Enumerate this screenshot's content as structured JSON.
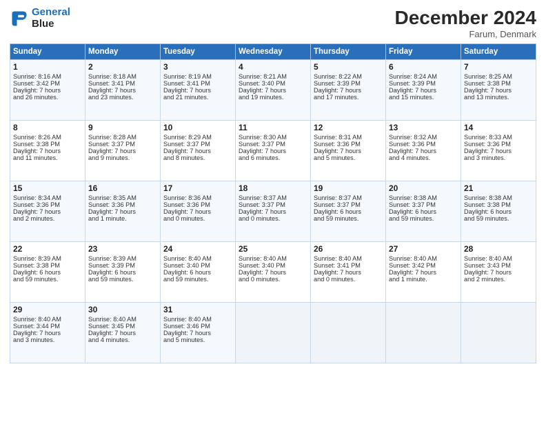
{
  "header": {
    "logo_line1": "General",
    "logo_line2": "Blue",
    "month_title": "December 2024",
    "subtitle": "Farum, Denmark"
  },
  "days_of_week": [
    "Sunday",
    "Monday",
    "Tuesday",
    "Wednesday",
    "Thursday",
    "Friday",
    "Saturday"
  ],
  "weeks": [
    [
      {
        "day": "1",
        "lines": [
          "Sunrise: 8:16 AM",
          "Sunset: 3:42 PM",
          "Daylight: 7 hours",
          "and 26 minutes."
        ]
      },
      {
        "day": "2",
        "lines": [
          "Sunrise: 8:18 AM",
          "Sunset: 3:41 PM",
          "Daylight: 7 hours",
          "and 23 minutes."
        ]
      },
      {
        "day": "3",
        "lines": [
          "Sunrise: 8:19 AM",
          "Sunset: 3:41 PM",
          "Daylight: 7 hours",
          "and 21 minutes."
        ]
      },
      {
        "day": "4",
        "lines": [
          "Sunrise: 8:21 AM",
          "Sunset: 3:40 PM",
          "Daylight: 7 hours",
          "and 19 minutes."
        ]
      },
      {
        "day": "5",
        "lines": [
          "Sunrise: 8:22 AM",
          "Sunset: 3:39 PM",
          "Daylight: 7 hours",
          "and 17 minutes."
        ]
      },
      {
        "day": "6",
        "lines": [
          "Sunrise: 8:24 AM",
          "Sunset: 3:39 PM",
          "Daylight: 7 hours",
          "and 15 minutes."
        ]
      },
      {
        "day": "7",
        "lines": [
          "Sunrise: 8:25 AM",
          "Sunset: 3:38 PM",
          "Daylight: 7 hours",
          "and 13 minutes."
        ]
      }
    ],
    [
      {
        "day": "8",
        "lines": [
          "Sunrise: 8:26 AM",
          "Sunset: 3:38 PM",
          "Daylight: 7 hours",
          "and 11 minutes."
        ]
      },
      {
        "day": "9",
        "lines": [
          "Sunrise: 8:28 AM",
          "Sunset: 3:37 PM",
          "Daylight: 7 hours",
          "and 9 minutes."
        ]
      },
      {
        "day": "10",
        "lines": [
          "Sunrise: 8:29 AM",
          "Sunset: 3:37 PM",
          "Daylight: 7 hours",
          "and 8 minutes."
        ]
      },
      {
        "day": "11",
        "lines": [
          "Sunrise: 8:30 AM",
          "Sunset: 3:37 PM",
          "Daylight: 7 hours",
          "and 6 minutes."
        ]
      },
      {
        "day": "12",
        "lines": [
          "Sunrise: 8:31 AM",
          "Sunset: 3:36 PM",
          "Daylight: 7 hours",
          "and 5 minutes."
        ]
      },
      {
        "day": "13",
        "lines": [
          "Sunrise: 8:32 AM",
          "Sunset: 3:36 PM",
          "Daylight: 7 hours",
          "and 4 minutes."
        ]
      },
      {
        "day": "14",
        "lines": [
          "Sunrise: 8:33 AM",
          "Sunset: 3:36 PM",
          "Daylight: 7 hours",
          "and 3 minutes."
        ]
      }
    ],
    [
      {
        "day": "15",
        "lines": [
          "Sunrise: 8:34 AM",
          "Sunset: 3:36 PM",
          "Daylight: 7 hours",
          "and 2 minutes."
        ]
      },
      {
        "day": "16",
        "lines": [
          "Sunrise: 8:35 AM",
          "Sunset: 3:36 PM",
          "Daylight: 7 hours",
          "and 1 minute."
        ]
      },
      {
        "day": "17",
        "lines": [
          "Sunrise: 8:36 AM",
          "Sunset: 3:36 PM",
          "Daylight: 7 hours",
          "and 0 minutes."
        ]
      },
      {
        "day": "18",
        "lines": [
          "Sunrise: 8:37 AM",
          "Sunset: 3:37 PM",
          "Daylight: 7 hours",
          "and 0 minutes."
        ]
      },
      {
        "day": "19",
        "lines": [
          "Sunrise: 8:37 AM",
          "Sunset: 3:37 PM",
          "Daylight: 6 hours",
          "and 59 minutes."
        ]
      },
      {
        "day": "20",
        "lines": [
          "Sunrise: 8:38 AM",
          "Sunset: 3:37 PM",
          "Daylight: 6 hours",
          "and 59 minutes."
        ]
      },
      {
        "day": "21",
        "lines": [
          "Sunrise: 8:38 AM",
          "Sunset: 3:38 PM",
          "Daylight: 6 hours",
          "and 59 minutes."
        ]
      }
    ],
    [
      {
        "day": "22",
        "lines": [
          "Sunrise: 8:39 AM",
          "Sunset: 3:38 PM",
          "Daylight: 6 hours",
          "and 59 minutes."
        ]
      },
      {
        "day": "23",
        "lines": [
          "Sunrise: 8:39 AM",
          "Sunset: 3:39 PM",
          "Daylight: 6 hours",
          "and 59 minutes."
        ]
      },
      {
        "day": "24",
        "lines": [
          "Sunrise: 8:40 AM",
          "Sunset: 3:40 PM",
          "Daylight: 6 hours",
          "and 59 minutes."
        ]
      },
      {
        "day": "25",
        "lines": [
          "Sunrise: 8:40 AM",
          "Sunset: 3:40 PM",
          "Daylight: 7 hours",
          "and 0 minutes."
        ]
      },
      {
        "day": "26",
        "lines": [
          "Sunrise: 8:40 AM",
          "Sunset: 3:41 PM",
          "Daylight: 7 hours",
          "and 0 minutes."
        ]
      },
      {
        "day": "27",
        "lines": [
          "Sunrise: 8:40 AM",
          "Sunset: 3:42 PM",
          "Daylight: 7 hours",
          "and 1 minute."
        ]
      },
      {
        "day": "28",
        "lines": [
          "Sunrise: 8:40 AM",
          "Sunset: 3:43 PM",
          "Daylight: 7 hours",
          "and 2 minutes."
        ]
      }
    ],
    [
      {
        "day": "29",
        "lines": [
          "Sunrise: 8:40 AM",
          "Sunset: 3:44 PM",
          "Daylight: 7 hours",
          "and 3 minutes."
        ]
      },
      {
        "day": "30",
        "lines": [
          "Sunrise: 8:40 AM",
          "Sunset: 3:45 PM",
          "Daylight: 7 hours",
          "and 4 minutes."
        ]
      },
      {
        "day": "31",
        "lines": [
          "Sunrise: 8:40 AM",
          "Sunset: 3:46 PM",
          "Daylight: 7 hours",
          "and 5 minutes."
        ]
      },
      {
        "day": "",
        "lines": []
      },
      {
        "day": "",
        "lines": []
      },
      {
        "day": "",
        "lines": []
      },
      {
        "day": "",
        "lines": []
      }
    ]
  ]
}
